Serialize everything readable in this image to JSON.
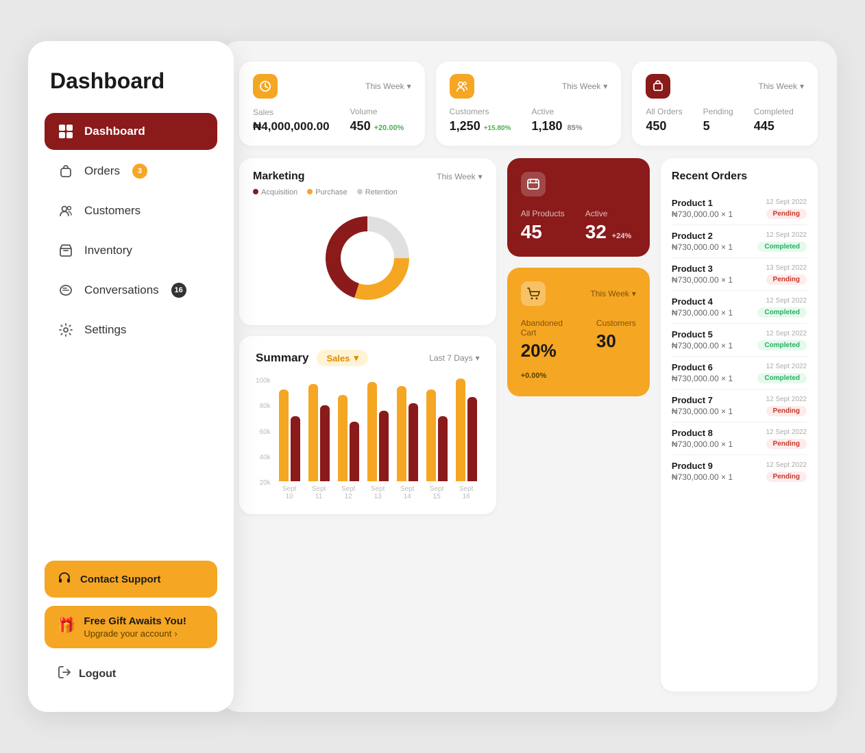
{
  "sidebar": {
    "title": "Dashboard",
    "nav_items": [
      {
        "label": "Dashboard",
        "icon": "grid",
        "active": true,
        "badge": null
      },
      {
        "label": "Orders",
        "icon": "bag",
        "active": false,
        "badge": "3"
      },
      {
        "label": "Customers",
        "icon": "users",
        "active": false,
        "badge": null
      },
      {
        "label": "Inventory",
        "icon": "box",
        "active": false,
        "badge": null
      },
      {
        "label": "Conversations",
        "icon": "chat",
        "active": false,
        "badge": "16"
      },
      {
        "label": "Settings",
        "icon": "gear",
        "active": false,
        "badge": null
      }
    ],
    "contact_support": "Contact Support",
    "free_gift_title": "Free Gift Awaits You!",
    "free_gift_sub": "Upgrade your account",
    "logout_label": "Logout"
  },
  "stats": {
    "sales_card": {
      "week_label": "This Week",
      "sales_label": "Sales",
      "sales_value": "₦4,000,000.00",
      "volume_label": "Volume",
      "volume_value": "450",
      "volume_change": "+20.00%"
    },
    "customers_card": {
      "week_label": "This Week",
      "customers_label": "Customers",
      "customers_value": "1,250",
      "customers_change": "+15.80%",
      "active_label": "Active",
      "active_value": "1,180",
      "active_pct": "85%"
    },
    "orders_card": {
      "week_label": "This Week",
      "all_label": "All Orders",
      "all_value": "450",
      "pending_label": "Pending",
      "pending_value": "5",
      "completed_label": "Completed",
      "completed_value": "445"
    }
  },
  "marketing": {
    "title": "Marketing",
    "week_label": "This Week",
    "legend": [
      {
        "label": "Acquisition",
        "color": "#8B1A1A"
      },
      {
        "label": "Purchase",
        "color": "#F5A623"
      },
      {
        "label": "Retention",
        "color": "#ccc"
      }
    ],
    "donut": {
      "acquisition_pct": 45,
      "purchase_pct": 30,
      "retention_pct": 25
    }
  },
  "products": {
    "icon": "folder",
    "all_label": "All Products",
    "all_value": "45",
    "active_label": "Active",
    "active_value": "32",
    "active_change": "+24%"
  },
  "abandoned_cart": {
    "week_label": "This Week",
    "cart_label": "Abandoned Cart",
    "cart_value": "20%",
    "cart_change": "+0.00%",
    "customers_label": "Customers",
    "customers_value": "30"
  },
  "recent_orders": {
    "title": "Recent Orders",
    "orders": [
      {
        "name": "Product 1",
        "amount": "₦730,000.00 × 1",
        "date": "12 Sept 2022",
        "status": "Pending"
      },
      {
        "name": "Product 2",
        "amount": "₦730,000.00 × 1",
        "date": "12 Sept 2022",
        "status": "Completed"
      },
      {
        "name": "Product 3",
        "amount": "₦730,000.00 × 1",
        "date": "13 Sept 2022",
        "status": "Pending"
      },
      {
        "name": "Product 4",
        "amount": "₦730,000.00 × 1",
        "date": "12 Sept 2022",
        "status": "Completed"
      },
      {
        "name": "Product 5",
        "amount": "₦730,000.00 × 1",
        "date": "12 Sept 2022",
        "status": "Completed"
      },
      {
        "name": "Product 6",
        "amount": "₦730,000.00 × 1",
        "date": "12 Sept 2022",
        "status": "Completed"
      },
      {
        "name": "Product 7",
        "amount": "₦730,000.00 × 1",
        "date": "12 Sept 2022",
        "status": "Pending"
      },
      {
        "name": "Product 8",
        "amount": "₦730,000.00 × 1",
        "date": "12 Sept 2022",
        "status": "Pending"
      },
      {
        "name": "Product 9",
        "amount": "₦730,000.00 × 1",
        "date": "12 Sept 2022",
        "status": "Pending"
      }
    ]
  },
  "summary": {
    "title": "Summary",
    "filter_label": "Sales",
    "period_label": "Last 7 Days",
    "y_labels": [
      "100k",
      "80k",
      "60k",
      "40k",
      "20k",
      ""
    ],
    "bars": [
      {
        "x": "Sept 10",
        "gold_h": 85,
        "red_h": 60
      },
      {
        "x": "Sept 11",
        "gold_h": 90,
        "red_h": 70
      },
      {
        "x": "Sept 12",
        "gold_h": 80,
        "red_h": 55
      },
      {
        "x": "Sept 13",
        "gold_h": 92,
        "red_h": 65
      },
      {
        "x": "Sept 14",
        "gold_h": 88,
        "red_h": 72
      },
      {
        "x": "Sept 15",
        "gold_h": 85,
        "red_h": 60
      },
      {
        "x": "Sept 16",
        "gold_h": 95,
        "red_h": 78
      }
    ]
  },
  "icons": {
    "grid": "⊞",
    "bag": "🛍",
    "users": "👥",
    "box": "📦",
    "chat": "💬",
    "gear": "⚙",
    "chevron_down": "▾",
    "headphones": "🎧",
    "gift": "🎁",
    "logout_arrow": "→",
    "folder": "📁",
    "cart": "🛒"
  }
}
